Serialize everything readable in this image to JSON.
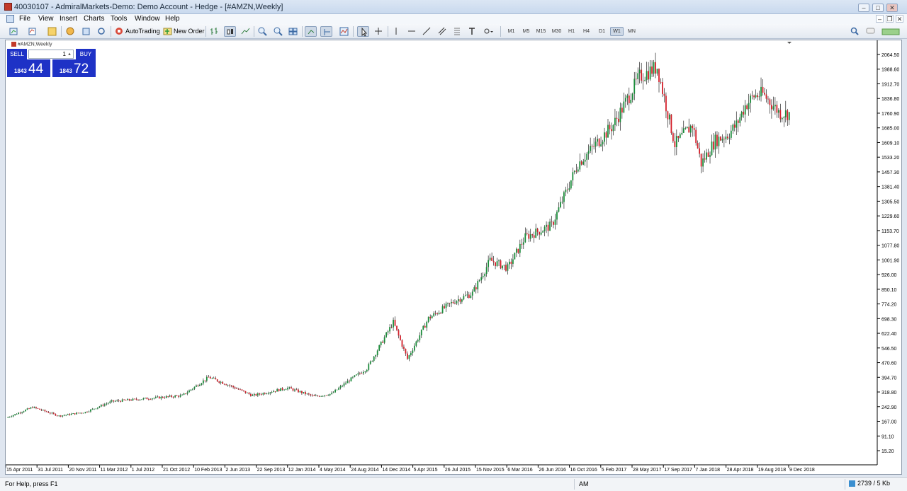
{
  "window": {
    "title": "40030107 - AdmiralMarkets-Demo: Demo Account - Hedge - [#AMZN,Weekly]"
  },
  "menu": {
    "items": [
      "File",
      "View",
      "Insert",
      "Charts",
      "Tools",
      "Window",
      "Help"
    ]
  },
  "toolbar": {
    "autotrading_label": "AutoTrading",
    "new_order_label": "New Order",
    "timeframes": [
      "M1",
      "M5",
      "M15",
      "M30",
      "H1",
      "H4",
      "D1",
      "W1",
      "MN"
    ],
    "active_timeframe": "W1"
  },
  "chart": {
    "caption": "#AMZN,Weekly",
    "symbol": "#AMZN",
    "timeframe": "Weekly"
  },
  "one_click": {
    "sell_label": "SELL",
    "buy_label": "BUY",
    "lot_value": "1",
    "sell_price_small": "1843",
    "sell_price_big": "44",
    "buy_price_small": "1843",
    "buy_price_big": "72",
    "color": "#1e32c6"
  },
  "chart_data": {
    "type": "candlestick",
    "y_ticks": [
      "15.20",
      "91.10",
      "167.00",
      "242.90",
      "318.80",
      "394.70",
      "470.60",
      "546.50",
      "622.40",
      "698.30",
      "774.20",
      "850.10",
      "926.00",
      "1001.90",
      "1077.80",
      "1153.70",
      "1229.60",
      "1305.50",
      "1381.40",
      "1457.30",
      "1533.20",
      "1609.10",
      "1685.00",
      "1760.90",
      "1836.80",
      "1912.70",
      "1988.60",
      "2064.50"
    ],
    "x_ticks": [
      "15 Apr 2011",
      "31 Jul 2011",
      "20 Nov 2011",
      "11 Mar 2012",
      "1 Jul 2012",
      "21 Oct 2012",
      "10 Feb 2013",
      "2 Jun 2013",
      "22 Sep 2013",
      "12 Jan 2014",
      "4 May 2014",
      "24 Aug 2014",
      "14 Dec 2014",
      "5 Apr 2015",
      "26 Jul 2015",
      "15 Nov 2015",
      "6 Mar 2016",
      "26 Jun 2016",
      "16 Oct 2016",
      "5 Feb 2017",
      "28 May 2017",
      "17 Sep 2017",
      "7 Jan 2018",
      "28 Apr 2018",
      "19 Aug 2018",
      "9 Dec 2018"
    ],
    "ylim": [
      15.2,
      2064.5
    ],
    "up_color": "#1a8c3a",
    "down_color": "#d41f2a",
    "path_weeks": [
      0,
      15,
      30,
      45,
      60,
      80,
      100,
      115,
      125,
      140,
      160,
      175,
      185,
      195,
      205,
      220,
      228,
      240,
      255,
      265,
      275,
      285,
      295,
      310,
      325,
      335,
      345,
      360,
      370,
      380,
      390,
      395,
      403,
      410,
      415,
      420,
      425,
      430,
      440
    ],
    "path_close": [
      185,
      240,
      195,
      215,
      270,
      285,
      300,
      395,
      360,
      300,
      340,
      295,
      310,
      380,
      440,
      680,
      490,
      700,
      790,
      830,
      1000,
      960,
      1120,
      1180,
      1500,
      1600,
      1700,
      1950,
      2000,
      1600,
      1700,
      1500,
      1620,
      1650,
      1700,
      1800,
      1850,
      1860,
      1760
    ],
    "weeks": 445
  },
  "status": {
    "help_text": "For Help, press F1",
    "profile": "AM",
    "traffic": "2739 / 5 Kb"
  }
}
